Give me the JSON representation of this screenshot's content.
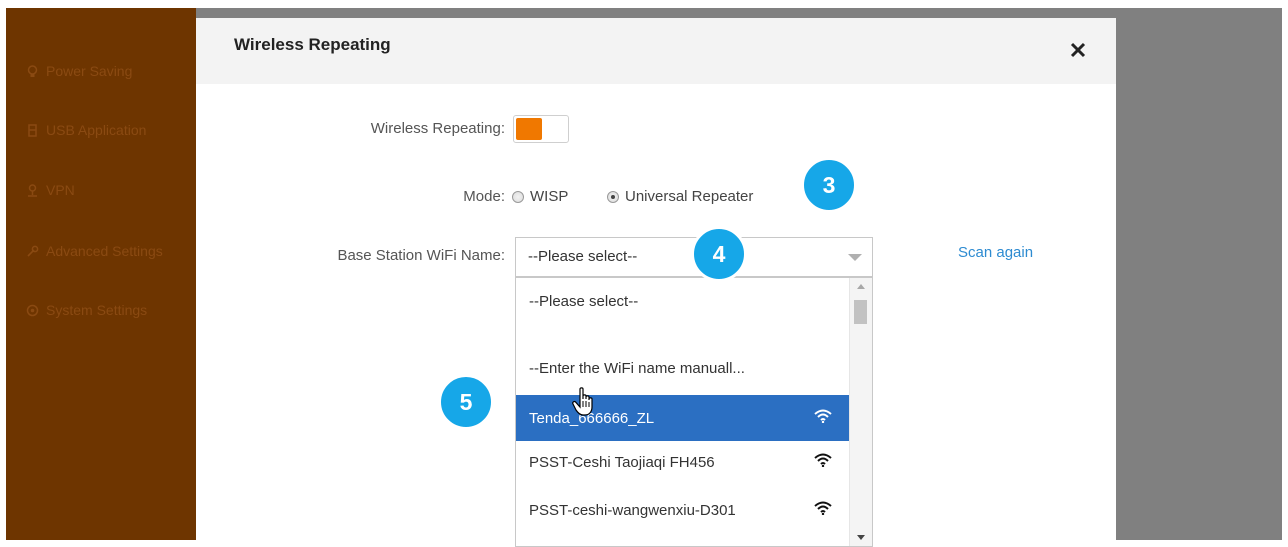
{
  "sidebar": {
    "items": [
      {
        "label": "Power Saving",
        "icon": "lightbulb-icon"
      },
      {
        "label": "USB Application",
        "icon": "usb-icon"
      },
      {
        "label": "VPN",
        "icon": "vpn-icon"
      },
      {
        "label": "Advanced Settings",
        "icon": "wrench-icon"
      },
      {
        "label": "System Settings",
        "icon": "gear-icon"
      }
    ]
  },
  "modal": {
    "title": "Wireless Repeating",
    "close_icon": "close-icon"
  },
  "form": {
    "repeating_label": "Wireless Repeating:",
    "repeating_on": true,
    "mode_label": "Mode:",
    "mode_options": [
      "WISP",
      "Universal Repeater"
    ],
    "mode_selected": "Universal Repeater",
    "base_station_label": "Base Station WiFi Name:",
    "base_station_value": "--Please select--",
    "scan_again": "Scan again"
  },
  "dropdown": {
    "options": [
      {
        "label": "--Please select--",
        "wifi": false
      },
      {
        "label": "--Enter the WiFi name manuall...",
        "wifi": false
      },
      {
        "label": "Tenda_666666_ZL",
        "wifi": true,
        "selected": true
      },
      {
        "label": "PSST-Ceshi Taojiaqi FH456",
        "wifi": true
      },
      {
        "label": "PSST-ceshi-wangwenxiu-D301",
        "wifi": true
      }
    ]
  },
  "callouts": [
    "3",
    "4",
    "5"
  ],
  "colors": {
    "sidebar": "#6e3500",
    "toggle_on": "#f07800",
    "selected_option": "#2b6fc2",
    "badge": "#16a7e8",
    "link": "#2d8bd1"
  }
}
